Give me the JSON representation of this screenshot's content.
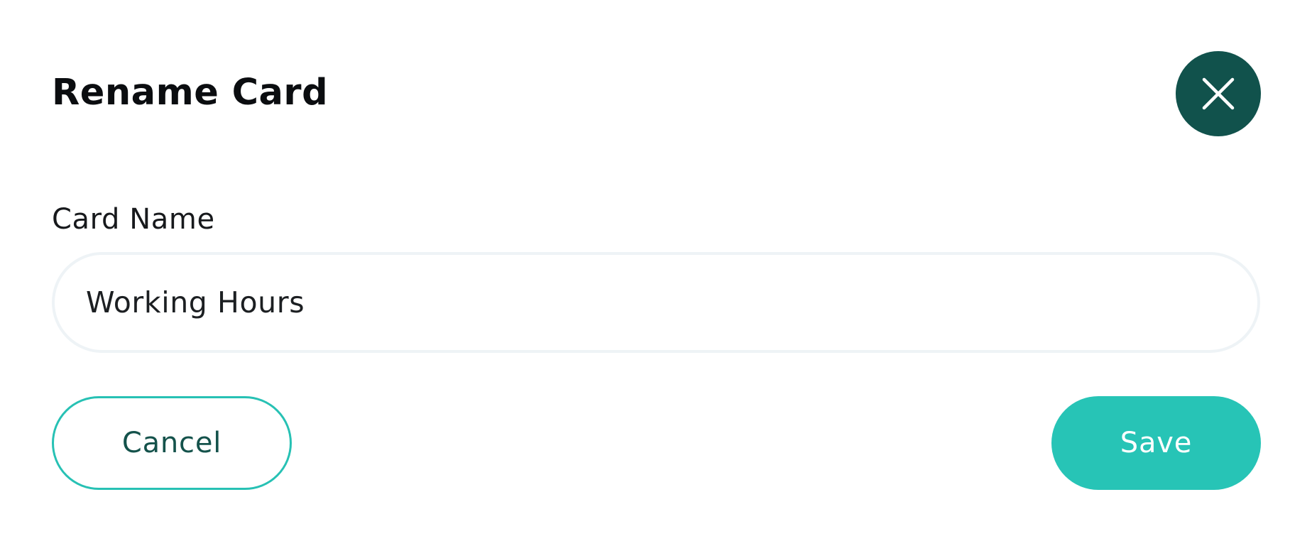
{
  "dialog": {
    "title": "Rename Card",
    "close_icon": "close-icon"
  },
  "form": {
    "label": "Card Name",
    "value": "Working Hours"
  },
  "actions": {
    "cancel_label": "Cancel",
    "save_label": "Save"
  },
  "colors": {
    "primary_dark": "#11524c",
    "accent": "#27c4b6",
    "title_text": "#0b0d10",
    "input_border": "#eef3f6"
  }
}
